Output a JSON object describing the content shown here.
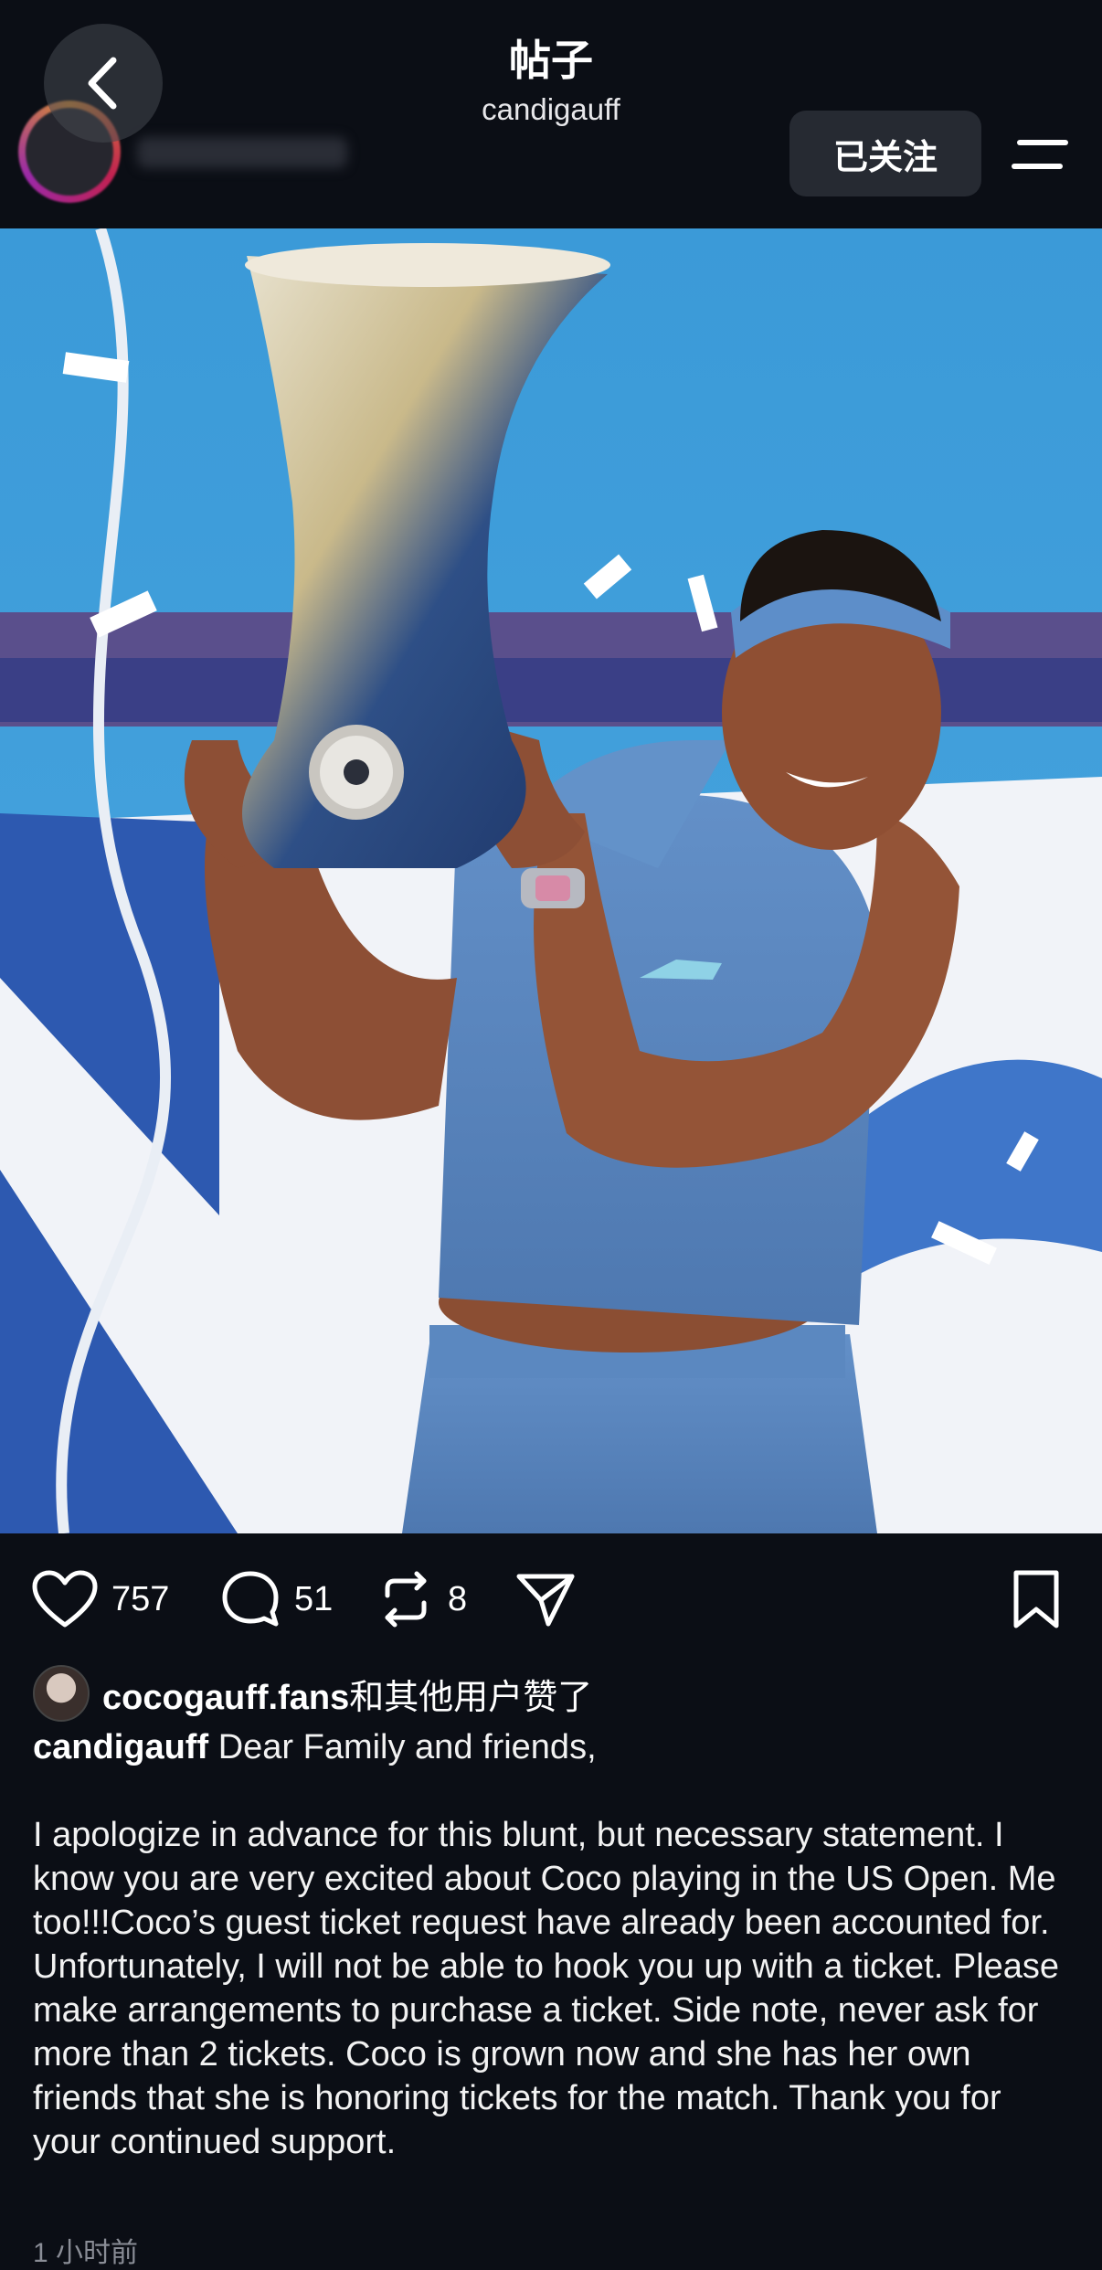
{
  "header": {
    "title": "帖子",
    "subtitle": "candigauff",
    "follow_label": "已关注"
  },
  "icons": {
    "back": "chevron-left-icon",
    "menu": "menu-icon",
    "like": "heart-icon",
    "comment": "comment-bubble-icon",
    "repost": "repost-icon",
    "share": "send-icon",
    "save": "bookmark-icon"
  },
  "actions": {
    "likes": "757",
    "comments": "51",
    "reposts": "8"
  },
  "liked_by": {
    "user": "cocogauff.fans",
    "suffix": "和其他用户赞了"
  },
  "caption": {
    "username": "candigauff",
    "first_line": "Dear Family and friends,",
    "body": "I apologize in advance for this blunt, but necessary statement. I know you are very excited about Coco playing in the US Open. Me too!!!Coco’s guest ticket request have already been accounted for. Unfortunately, I will not be able to hook you up with a ticket. Please make arrangements to purchase a ticket. Side note, never ask for more than 2 tickets. Coco is grown now and she has her own friends that she is honoring tickets for the match. Thank you for your continued support."
  },
  "time": "1 小时前",
  "colors": {
    "background": "#0b0e15",
    "follow_button": "#262a32",
    "sky": "#3fa0dc",
    "outfit": "#5a86bf"
  }
}
